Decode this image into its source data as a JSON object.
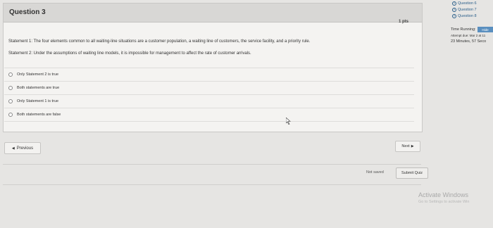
{
  "question": {
    "title": "Question 3",
    "points": "1 pts",
    "statement1": "Statement 1: The four elements common to all waiting-line situations are a customer population, a waiting line of customers, the service facility, and a priority rule.",
    "statement2": "Statement 2: Under the assumptions of waiting line models, it is impossible for management to affect the rate of customer arrivals.",
    "answers": [
      "Only Statement 2 is true",
      "Both statements are true",
      "Only Statement 1 is true",
      "Both statements are false"
    ]
  },
  "navigation": {
    "previous_label": "Previous",
    "next_label": "Next",
    "not_saved": "Not saved",
    "submit_label": "Submit Quiz"
  },
  "sidebar": {
    "questions": [
      "Question 6",
      "Question 7",
      "Question 8"
    ],
    "time_running_label": "Time Running:",
    "hide_label": "Hide",
    "attempt_due": "Attempt due: Mar 2 at 11",
    "timer": "23 Minutes, 57 Seco"
  },
  "watermark": {
    "title": "Activate Windows",
    "subtitle": "Go to Settings to activate Win"
  },
  "icons": {
    "prev": "chevron-left-icon",
    "next": "chevron-right-icon",
    "question": "question-mark-icon",
    "cursor": "mouse-cursor-icon"
  }
}
